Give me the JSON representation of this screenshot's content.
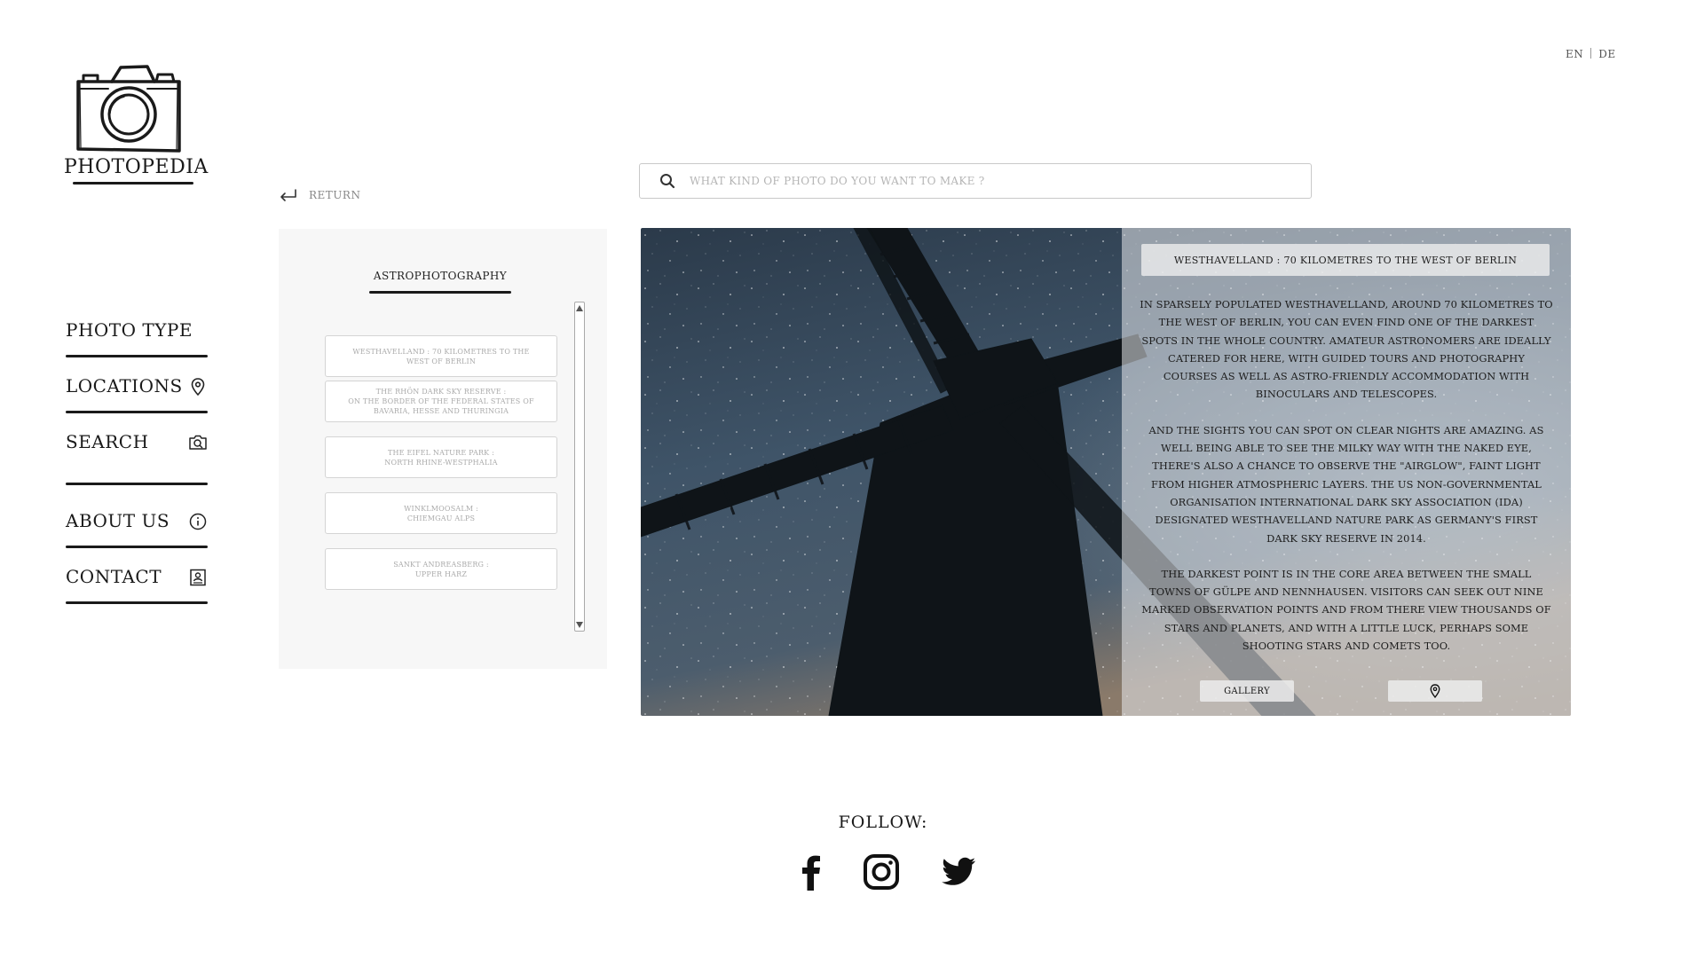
{
  "lang": {
    "en": "EN",
    "de": "DE"
  },
  "logo": {
    "title": "PHOTOPEDIA",
    "icon": "camera-icon"
  },
  "nav": {
    "items": [
      {
        "label": "PHOTO TYPE",
        "icon": ""
      },
      {
        "label": "LOCATIONS",
        "icon": "location-pin-icon"
      },
      {
        "label": "SEARCH",
        "icon": "camera-search-icon"
      },
      {
        "label": "ABOUT US",
        "icon": "info-icon"
      },
      {
        "label": "CONTACT",
        "icon": "contact-card-icon"
      }
    ]
  },
  "return_label": "RETURN",
  "search": {
    "placeholder": "WHAT KIND OF PHOTO DO YOU WANT TO MAKE ?"
  },
  "panel": {
    "title": "ASTROPHOTOGRAPHY",
    "items": [
      "WESTHAVELLAND : 70 KILOMETRES TO THE\nWEST OF BERLIN",
      "THE RHÖN DARK SKY RESERVE :\nON THE BORDER OF THE FEDERAL STATES OF\nBAVARIA, HESSE AND THURINGIA",
      "THE EIFEL NATURE PARK :\nNORTH RHINE-WESTPHALIA",
      "WINKLMOOSALM :\nCHIEMGAU ALPS",
      "SANKT ANDREASBERG :\nUPPER HARZ"
    ]
  },
  "detail": {
    "title": "WESTHAVELLAND : 70 KILOMETRES TO THE WEST OF BERLIN",
    "paragraphs": [
      "IN SPARSELY POPULATED WESTHAVELLAND, AROUND 70 KILOMETRES TO THE WEST OF BERLIN, YOU CAN EVEN FIND ONE OF THE DARKEST SPOTS IN THE WHOLE COUNTRY. AMATEUR ASTRONOMERS ARE IDEALLY CATERED FOR HERE, WITH GUIDED TOURS AND PHOTOGRAPHY COURSES AS WELL AS ASTRO-FRIENDLY ACCOMMODATION WITH BINOCULARS AND TELESCOPES.",
      "AND THE SIGHTS YOU CAN SPOT ON CLEAR NIGHTS ARE AMAZING. AS WELL BEING ABLE TO SEE THE MILKY WAY WITH THE NAKED EYE, THERE'S ALSO A CHANCE TO OBSERVE THE \"AIRGLOW\", FAINT LIGHT FROM HIGHER ATMOSPHERIC LAYERS. THE US NON-GOVERNMENTAL ORGANISATION INTERNATIONAL DARK SKY ASSOCIATION (IDA) DESIGNATED WESTHAVELLAND NATURE PARK AS GERMANY'S FIRST DARK SKY RESERVE IN 2014.",
      "THE DARKEST POINT IS IN THE CORE AREA BETWEEN THE SMALL TOWNS OF GÜLPE AND NENNHAUSEN. VISITORS CAN SEEK OUT NINE MARKED OBSERVATION POINTS AND FROM THERE VIEW THOUSANDS OF STARS AND PLANETS, AND WITH A LITTLE LUCK, PERHAPS SOME SHOOTING STARS AND COMETS TOO."
    ],
    "gallery_label": "GALLERY",
    "map_icon": "location-pin-icon"
  },
  "follow": {
    "label": "FOLLOW:",
    "icons": [
      "facebook-icon",
      "instagram-icon",
      "twitter-icon"
    ]
  }
}
